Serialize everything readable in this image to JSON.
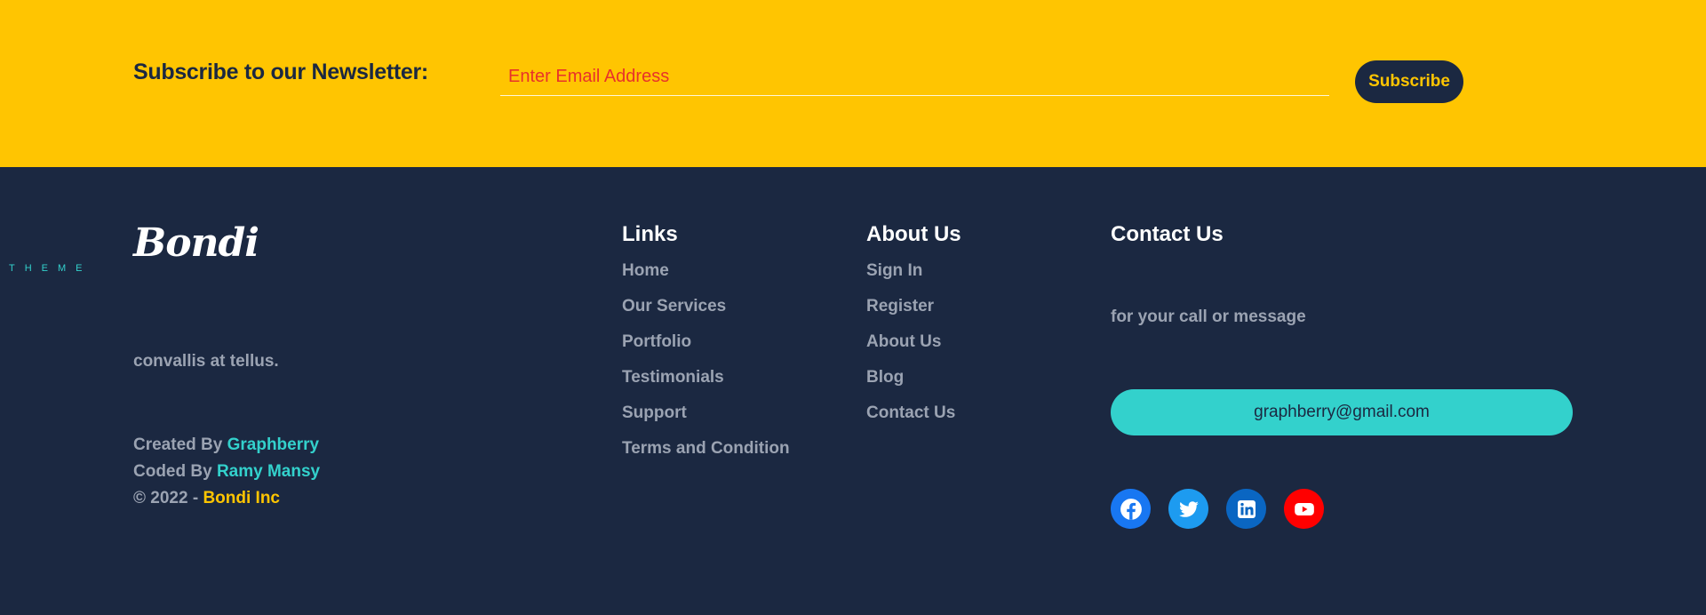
{
  "newsletter": {
    "title": "Subscribe to our Newsletter:",
    "email_placeholder": "Enter Email Address",
    "button_label": "Subscribe"
  },
  "brand": {
    "logo_text": "Bondi",
    "logo_subtext": "THEME",
    "description": "convallis at tellus."
  },
  "credits": {
    "created_prefix": "Created By ",
    "created_name": "Graphberry",
    "coded_prefix": "Coded By ",
    "coded_name": "Ramy Mansy",
    "copyright_prefix": "© 2022 - ",
    "copyright_name": "Bondi Inc"
  },
  "links": {
    "title": "Links",
    "items": [
      "Home",
      "Our Services",
      "Portfolio",
      "Testimonials",
      "Support",
      "Terms and Condition"
    ]
  },
  "about": {
    "title": "About Us",
    "items": [
      "Sign In",
      "Register",
      "About Us",
      "Blog",
      "Contact Us"
    ]
  },
  "contact": {
    "title": "Contact Us",
    "note": "for your call or message",
    "email": "graphberry@gmail.com"
  },
  "socials": [
    {
      "icon": "facebook-icon",
      "color": "#1877f2"
    },
    {
      "icon": "twitter-icon",
      "color": "#1d9bf0"
    },
    {
      "icon": "linkedin-icon",
      "color": "#0a66c2"
    },
    {
      "icon": "youtube-icon",
      "color": "#ff0000"
    }
  ],
  "colors": {
    "brand_yellow": "#ffc501",
    "navy": "#1b2841",
    "teal": "#33d1cc",
    "muted_text": "#9ba3b2",
    "placeholder_red": "#e8322a"
  }
}
